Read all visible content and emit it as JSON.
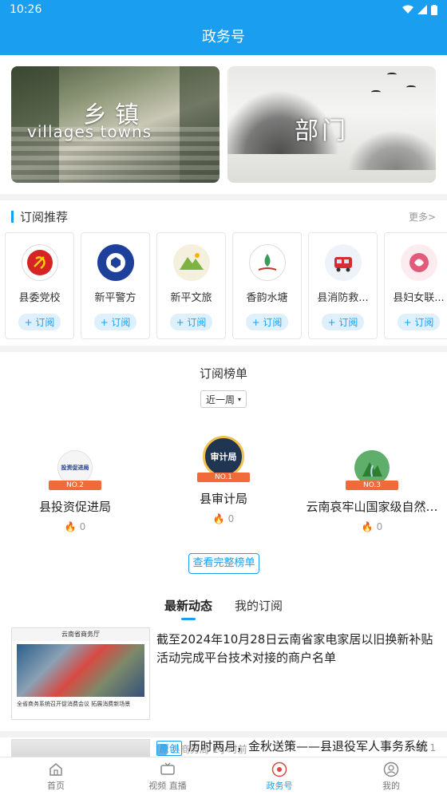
{
  "status": {
    "time": "10:26"
  },
  "header": {
    "title": "政务号"
  },
  "hero": {
    "villages": {
      "title": "乡镇",
      "subtitle": "villages   towns"
    },
    "department": {
      "title": "部门"
    }
  },
  "recommend": {
    "title": "订阅推荐",
    "more": "更多>",
    "subscribe_label": "+ 订阅",
    "items": [
      {
        "name": "县委党校",
        "icon": "party-emblem-icon"
      },
      {
        "name": "新平警方",
        "icon": "police-badge-icon"
      },
      {
        "name": "新平文旅",
        "icon": "mountain-tourism-icon"
      },
      {
        "name": "香韵水塘",
        "icon": "water-pond-icon"
      },
      {
        "name": "县消防救...",
        "icon": "fire-truck-icon"
      },
      {
        "name": "县妇女联...",
        "icon": "women-federation-icon"
      }
    ]
  },
  "ranking": {
    "title": "订阅榜单",
    "period": "近一周",
    "podium": [
      {
        "rank_label": "NO.2",
        "name": "县投资促进局",
        "heat": "0",
        "emblem_text": "投资促进局"
      },
      {
        "rank_label": "NO.1",
        "name": "县审计局",
        "heat": "0",
        "emblem_text": "审计局"
      },
      {
        "rank_label": "NO.3",
        "name": "云南哀牢山国家级自然…",
        "heat": "0",
        "emblem_text": ""
      }
    ],
    "full_button": "查看完整榜单"
  },
  "news": {
    "tabs": [
      "最新动态",
      "我的订阅"
    ],
    "items": [
      {
        "thumb_header": "云南省商务厅",
        "thumb_caption": "全省商务系统召开促消费会议 拓展消费新场景",
        "title": "截至2024年10月28日云南省家电家居以旧换新补贴活动完成平台技术对接的商户名单",
        "source": "县商务局",
        "time": "1小时前",
        "views": "1"
      },
      {
        "tag": "原创",
        "title": "历时两月，金秋送策——县退役军人事务系统巡回政策宣讲开启新征程"
      }
    ]
  },
  "bottom_nav": [
    {
      "label": "首页",
      "icon": "home-icon"
    },
    {
      "label": "视频 直播",
      "icon": "tv-icon"
    },
    {
      "label": "政务号",
      "icon": "gov-emblem-icon",
      "active": true
    },
    {
      "label": "我的",
      "icon": "user-icon"
    }
  ]
}
